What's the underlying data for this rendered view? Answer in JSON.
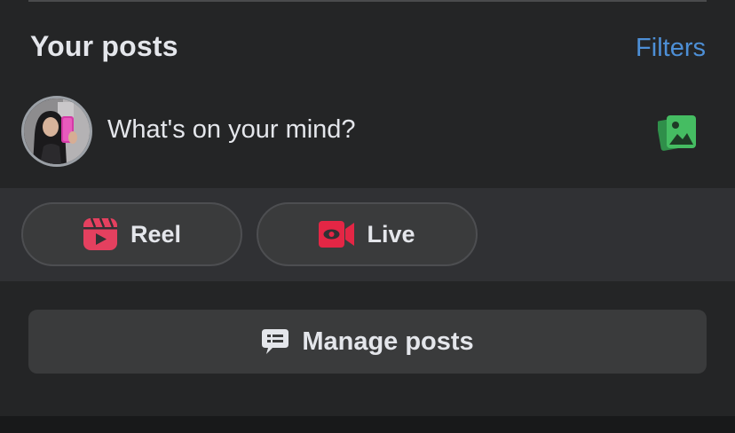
{
  "section": {
    "title": "Your posts",
    "filters_label": "Filters"
  },
  "composer": {
    "prompt": "What's on your mind?",
    "avatar_icon": "profile-avatar",
    "photo_icon": "photo-gallery-icon"
  },
  "actions": {
    "reel_label": "Reel",
    "reel_icon": "reel-icon",
    "live_label": "Live",
    "live_icon": "live-video-icon"
  },
  "manage": {
    "label": "Manage posts",
    "icon": "message-list-icon"
  },
  "colors": {
    "background": "#242526",
    "band": "#303134",
    "button": "#3a3b3c",
    "accent_blue": "#4d8fd6",
    "reel_red": "#e4405f",
    "live_red": "#e42645",
    "photo_green": "#45bd62",
    "text": "#e4e6eb"
  }
}
